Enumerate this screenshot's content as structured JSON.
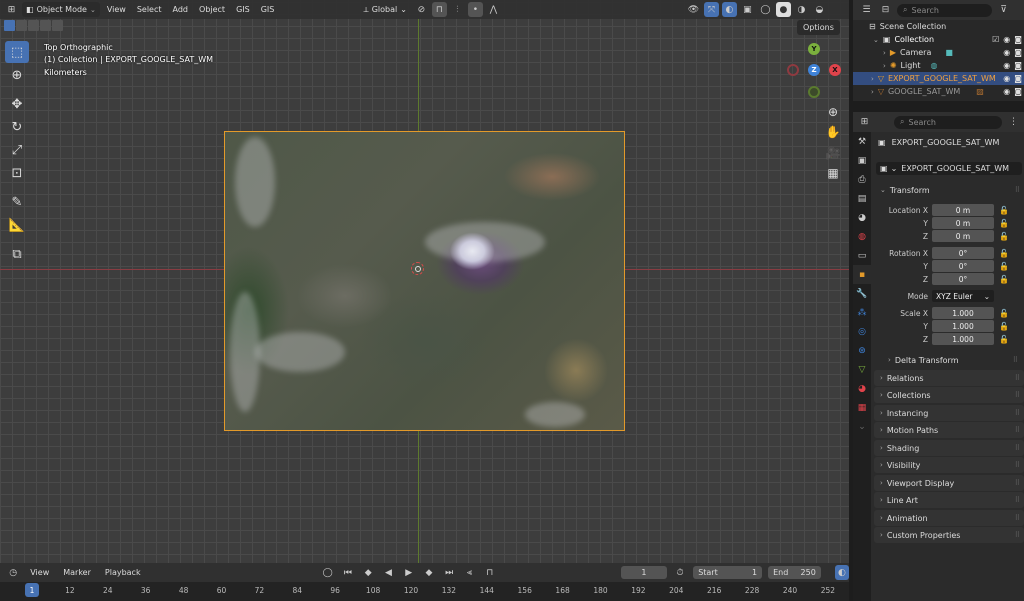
{
  "viewport": {
    "header": {
      "mode": "Object Mode",
      "menus": [
        "View",
        "Select",
        "Add",
        "Object",
        "GIS",
        "GIS"
      ],
      "orientation": "Global"
    },
    "info": {
      "view_name": "Top Orthographic",
      "collection_line": "(1) Collection | EXPORT_GOOGLE_SAT_WM",
      "units": "Kilometers"
    },
    "options_label": "Options",
    "gizmo": {
      "y": "Y",
      "x": "X",
      "z": "Z"
    }
  },
  "timeline": {
    "menus": [
      "View",
      "Marker",
      "Playback"
    ],
    "current_frame": "1",
    "start_label": "Start",
    "start_value": "1",
    "end_label": "End",
    "end_value": "250",
    "ticks": [
      "1",
      "12",
      "24",
      "36",
      "48",
      "60",
      "72",
      "84",
      "96",
      "108",
      "120",
      "132",
      "144",
      "156",
      "168",
      "180",
      "192",
      "204",
      "216",
      "228",
      "240",
      "252"
    ]
  },
  "outliner": {
    "search_placeholder": "Search",
    "rows": [
      {
        "label": "Scene Collection"
      },
      {
        "label": "Collection"
      },
      {
        "label": "Camera"
      },
      {
        "label": "Light"
      },
      {
        "label": "EXPORT_GOOGLE_SAT_WM"
      },
      {
        "label": "GOOGLE_SAT_WM"
      }
    ]
  },
  "properties": {
    "search_placeholder": "Search",
    "object_name": "EXPORT_GOOGLE_SAT_WM",
    "object_selector": "EXPORT_GOOGLE_SAT_WM",
    "transform": {
      "title": "Transform",
      "location_label": "Location X",
      "location": [
        "0 m",
        "0 m",
        "0 m"
      ],
      "rotation_label": "Rotation X",
      "rotation": [
        "0°",
        "0°",
        "0°"
      ],
      "mode_label": "Mode",
      "mode_value": "XYZ Euler",
      "scale_label": "Scale X",
      "scale": [
        "1.000",
        "1.000",
        "1.000"
      ],
      "y_label": "Y",
      "z_label": "Z",
      "delta": "Delta Transform"
    },
    "panels": [
      "Relations",
      "Collections",
      "Instancing",
      "Motion Paths",
      "Shading",
      "Visibility",
      "Viewport Display",
      "Line Art",
      "Animation",
      "Custom Properties"
    ]
  },
  "colors": {
    "accent": "#4772b3",
    "selection_outline": "#e39a2a",
    "axis_x": "#e0434b",
    "axis_y": "#7bb03d",
    "axis_z": "#3f83d9"
  }
}
